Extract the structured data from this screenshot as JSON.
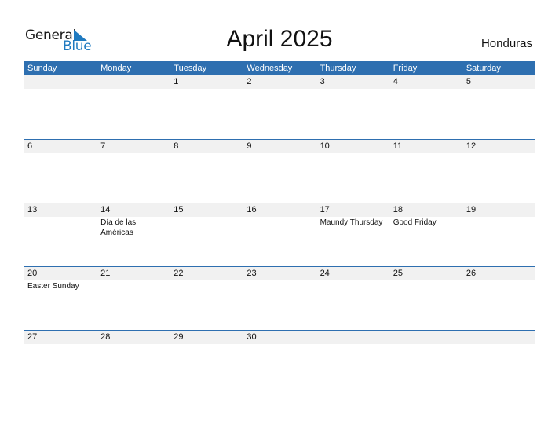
{
  "logo": {
    "general": "General",
    "blue": "Blue"
  },
  "title": "April 2025",
  "country": "Honduras",
  "colors": {
    "header_bg": "#2e6fb0",
    "strip_bg": "#f1f1f1",
    "logo_blue": "#1f7ac0"
  },
  "weekdays": [
    "Sunday",
    "Monday",
    "Tuesday",
    "Wednesday",
    "Thursday",
    "Friday",
    "Saturday"
  ],
  "weeks": [
    [
      {
        "day": ""
      },
      {
        "day": ""
      },
      {
        "day": "1"
      },
      {
        "day": "2"
      },
      {
        "day": "3"
      },
      {
        "day": "4"
      },
      {
        "day": "5"
      }
    ],
    [
      {
        "day": "6"
      },
      {
        "day": "7"
      },
      {
        "day": "8"
      },
      {
        "day": "9"
      },
      {
        "day": "10"
      },
      {
        "day": "11"
      },
      {
        "day": "12"
      }
    ],
    [
      {
        "day": "13"
      },
      {
        "day": "14",
        "holiday": "Día de las Américas"
      },
      {
        "day": "15"
      },
      {
        "day": "16"
      },
      {
        "day": "17",
        "holiday": "Maundy Thursday"
      },
      {
        "day": "18",
        "holiday": "Good Friday"
      },
      {
        "day": "19"
      }
    ],
    [
      {
        "day": "20",
        "holiday": "Easter Sunday"
      },
      {
        "day": "21"
      },
      {
        "day": "22"
      },
      {
        "day": "23"
      },
      {
        "day": "24"
      },
      {
        "day": "25"
      },
      {
        "day": "26"
      }
    ],
    [
      {
        "day": "27"
      },
      {
        "day": "28"
      },
      {
        "day": "29"
      },
      {
        "day": "30"
      },
      {
        "day": ""
      },
      {
        "day": ""
      },
      {
        "day": ""
      }
    ]
  ]
}
